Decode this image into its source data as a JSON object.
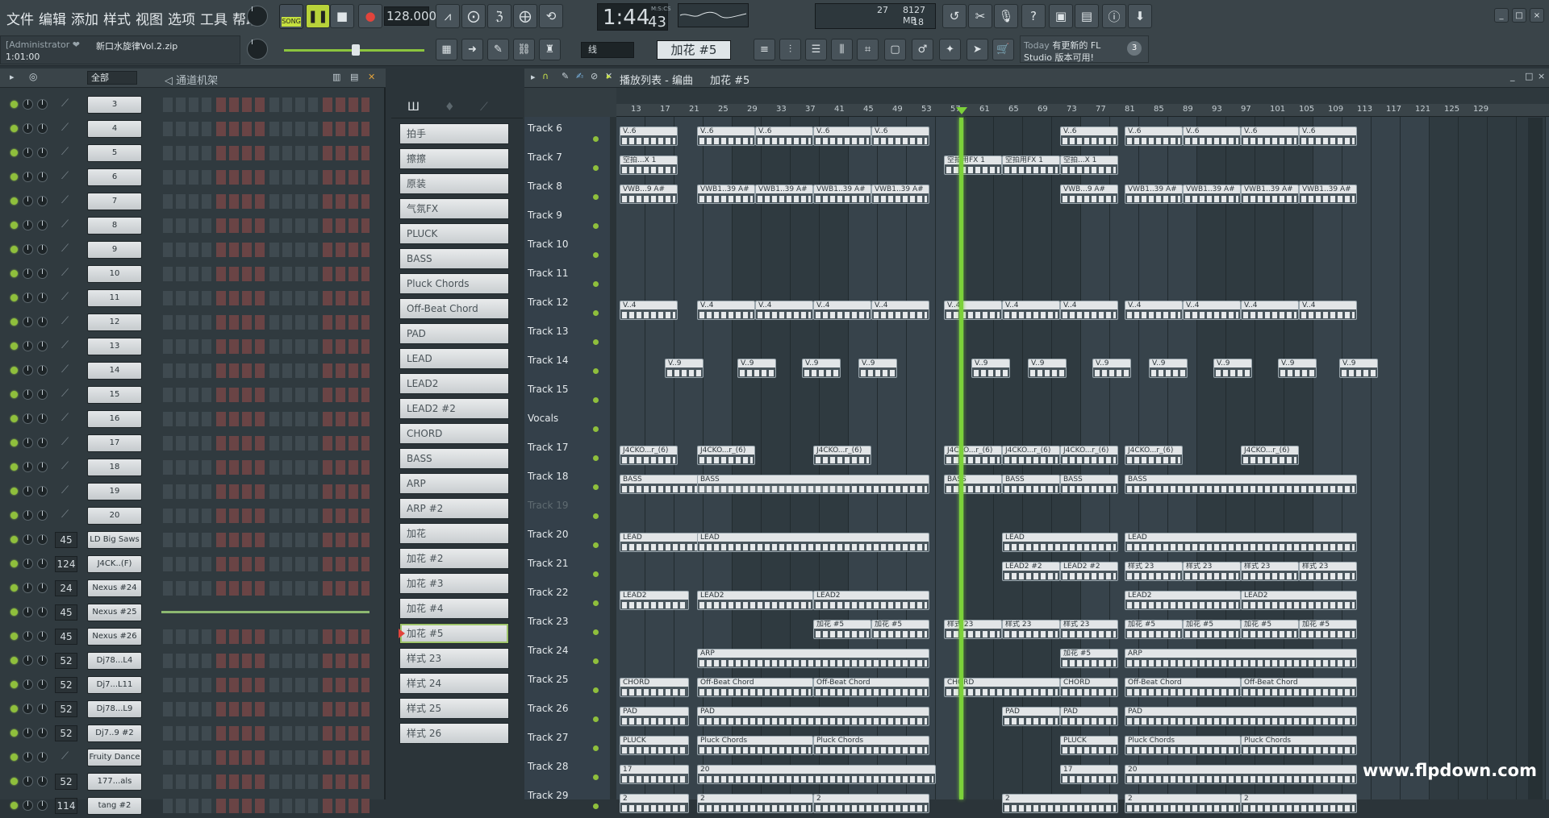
{
  "menu": [
    "文件",
    "编辑",
    "添加",
    "样式",
    "视图",
    "选项",
    "工具",
    "帮助"
  ],
  "transport": {
    "mode": "SONG",
    "tempo": "128.000",
    "time": "1:44",
    "time_sub": "43",
    "time_unit": "M:S:CS",
    "cpu": "27",
    "mem": "8127 MB",
    "poly": "18",
    "snap": "线",
    "pattern": "加花 #5"
  },
  "hint": {
    "user": "[Administrator ❤",
    "file": "新口水旋律Vol.2.zip",
    "time": "1:01:00"
  },
  "news": {
    "today": "Today",
    "line1": "有更新的 FL",
    "line2": "Studio 版本可用!",
    "count": "3"
  },
  "rack": {
    "filter": "全部",
    "title": "通道机架",
    "channels": [
      {
        "mix": "",
        "name": "3"
      },
      {
        "mix": "",
        "name": "4"
      },
      {
        "mix": "",
        "name": "5"
      },
      {
        "mix": "",
        "name": "6"
      },
      {
        "mix": "",
        "name": "7"
      },
      {
        "mix": "",
        "name": "8"
      },
      {
        "mix": "",
        "name": "9"
      },
      {
        "mix": "",
        "name": "10"
      },
      {
        "mix": "",
        "name": "11"
      },
      {
        "mix": "",
        "name": "12"
      },
      {
        "mix": "",
        "name": "13"
      },
      {
        "mix": "",
        "name": "14"
      },
      {
        "mix": "",
        "name": "15"
      },
      {
        "mix": "",
        "name": "16"
      },
      {
        "mix": "",
        "name": "17"
      },
      {
        "mix": "",
        "name": "18"
      },
      {
        "mix": "",
        "name": "19"
      },
      {
        "mix": "",
        "name": "20"
      },
      {
        "mix": "45",
        "name": "LD Big Saws"
      },
      {
        "mix": "124",
        "name": "J4CK..(F)"
      },
      {
        "mix": "24",
        "name": "Nexus #24"
      },
      {
        "mix": "45",
        "name": "Nexus #25"
      },
      {
        "mix": "45",
        "name": "Nexus #26"
      },
      {
        "mix": "52",
        "name": "Dj78...L4"
      },
      {
        "mix": "52",
        "name": "Dj7...L11"
      },
      {
        "mix": "52",
        "name": "Dj78...L9"
      },
      {
        "mix": "52",
        "name": "Dj7..9 #2"
      },
      {
        "mix": "",
        "name": "Fruity Dance"
      },
      {
        "mix": "52",
        "name": "177...als"
      },
      {
        "mix": "114",
        "name": "tang #2"
      }
    ]
  },
  "picker": [
    "拍手",
    "擦擦",
    "原装",
    "气氛FX",
    "PLUCK",
    "BASS",
    "Pluck Chords",
    "Off-Beat Chord",
    "PAD",
    "LEAD",
    "LEAD2",
    "LEAD2 #2",
    "CHORD",
    "BASS",
    "ARP",
    "ARP #2",
    "加花",
    "加花 #2",
    "加花 #3",
    "加花 #4",
    "加花 #5",
    "样式 23",
    "样式 24",
    "样式 25",
    "样式 26"
  ],
  "playlist": {
    "title": "播放列表 - 编曲",
    "pattern": "加花 #5",
    "bars": [
      "13",
      "17",
      "21",
      "25",
      "29",
      "33",
      "37",
      "41",
      "45",
      "49",
      "53",
      "57",
      "61",
      "65",
      "69",
      "73",
      "77",
      "81",
      "85",
      "89",
      "93",
      "97",
      "101",
      "105",
      "109",
      "113",
      "117",
      "121",
      "125",
      "129"
    ],
    "tracks": [
      "Track 6",
      "Track 7",
      "Track 8",
      "Track 9",
      "Track 10",
      "Track 11",
      "Track 12",
      "Track 13",
      "Track 14",
      "Track 15",
      "Vocals",
      "Track 17",
      "Track 18",
      "Track 19",
      "Track 20",
      "Track 21",
      "Track 22",
      "Track 23",
      "Track 24",
      "Track 25",
      "Track 26",
      "Track 27",
      "Track 28",
      "Track 29"
    ],
    "clip_labels": {
      "v6": "V..6",
      "kongpai": "空拍...X 1",
      "kongpaifx": "空拍用FX 1",
      "vwb": "VWB1..39 A#",
      "vwbs": "VWB...9 A#",
      "v4": "V..4",
      "v9": "V..9",
      "j4": "J4CKO...r_(6)",
      "bass": "BASS",
      "lead": "LEAD",
      "lead22": "LEAD2 #2",
      "style23": "样式 23",
      "lead2": "LEAD2",
      "jiahua5": "加花 #5",
      "arp": "ARP",
      "chord": "CHORD",
      "offbeat": "Off-Beat Chord",
      "pad": "PAD",
      "pluck": "PLUCK",
      "pluckchords": "Pluck Chords",
      "n17": "17",
      "n20": "20",
      "n2": "2"
    }
  },
  "watermark": "www.flpdown.com"
}
